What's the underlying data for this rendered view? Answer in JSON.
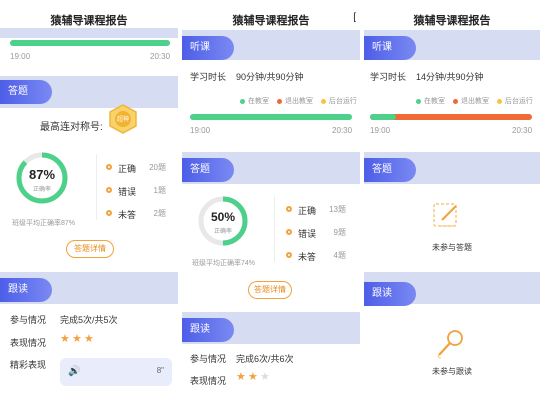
{
  "panel1": {
    "title": "猿辅导课程报告",
    "bar_start": "19:00",
    "bar_end": "20:30",
    "bar_attended_fraction": 1.0,
    "answer_header": "答题",
    "streak_label": "最高连对称号:",
    "badge_text": "超神",
    "accuracy_value": "87%",
    "accuracy_fraction": 0.87,
    "accuracy_label": "正确率",
    "class_avg": "班级平均正确率87%",
    "stats": [
      {
        "label": "正确",
        "count": "20题"
      },
      {
        "label": "错误",
        "count": "1题"
      },
      {
        "label": "未答",
        "count": "2题"
      }
    ],
    "details_button": "答题详情",
    "follow_header": "跟读",
    "participation_label": "参与情况",
    "participation_value": "完成5次/共5次",
    "performance_label": "表现情况",
    "performance_stars": 3,
    "highlight_label": "精彩表现",
    "audio_duration": "8\""
  },
  "panel2": {
    "title": "猿辅导课程报告",
    "listen_header": "听课",
    "study_time_label": "学习时长",
    "study_time_value": "90分钟/共90分钟",
    "legend": [
      "在教室",
      "退出教室",
      "后台运行"
    ],
    "bar_start": "19:00",
    "bar_end": "20:30",
    "bar_attended_fraction": 1.0,
    "answer_header": "答题",
    "accuracy_value": "50%",
    "accuracy_fraction": 0.5,
    "accuracy_label": "正确率",
    "class_avg": "班级平均正确率74%",
    "stats": [
      {
        "label": "正确",
        "count": "13题"
      },
      {
        "label": "错误",
        "count": "9题"
      },
      {
        "label": "未答",
        "count": "4题"
      }
    ],
    "details_button": "答题详情",
    "follow_header": "跟读",
    "participation_label": "参与情况",
    "participation_value": "完成6次/共6次",
    "performance_label": "表现情况",
    "performance_stars": 2
  },
  "panel3": {
    "title": "猿辅导课程报告",
    "listen_header": "听课",
    "study_time_label": "学习时长",
    "study_time_value": "14分钟/共90分钟",
    "legend": [
      "在教室",
      "退出教室",
      "后台运行"
    ],
    "bar_start": "19:00",
    "bar_end": "20:30",
    "bar_attended_fraction": 0.16,
    "answer_header": "答题",
    "no_answer_text": "未参与答题",
    "follow_header": "跟读",
    "no_follow_text": "未参与跟读"
  },
  "colors": {
    "in_class": "#4cd08a",
    "left_class": "#f06a35",
    "background": "#f5c542",
    "accent": "#5b6cf0",
    "orange": "#f2a23c"
  }
}
